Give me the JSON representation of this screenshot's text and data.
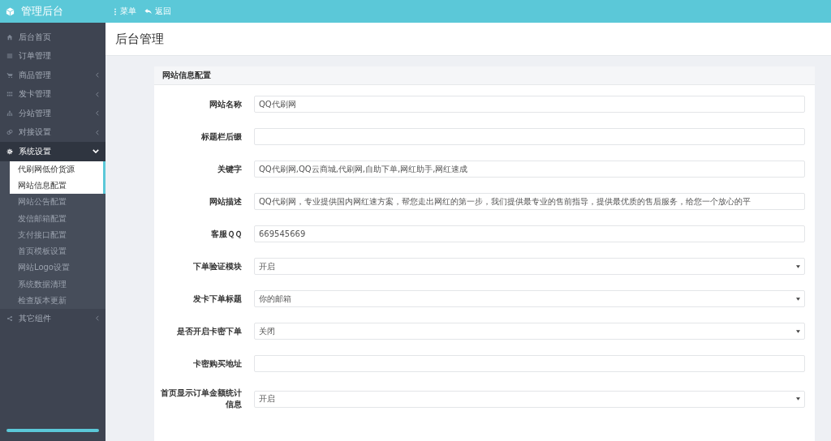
{
  "topbar": {
    "brand": "管理后台",
    "actions": [
      {
        "kind": "menu",
        "label": "菜单"
      },
      {
        "kind": "back",
        "label": "返回"
      }
    ]
  },
  "sidebar": {
    "items": [
      {
        "label": "后台首页"
      },
      {
        "label": "订单管理"
      },
      {
        "label": "商品管理",
        "expanded": false
      },
      {
        "label": "发卡管理",
        "expanded": false
      },
      {
        "label": "分站管理",
        "expanded": false
      },
      {
        "label": "对接设置",
        "expanded": false
      },
      {
        "label": "系统设置",
        "expanded": true,
        "children": [
          {
            "label": "代刷网低价货源",
            "selected": true
          },
          {
            "label": "网站信息配置",
            "selected": true
          },
          {
            "label": "网站公告配置",
            "selected": false
          },
          {
            "label": "发信邮箱配置",
            "selected": false
          },
          {
            "label": "支付接口配置",
            "selected": false
          },
          {
            "label": "首页模板设置",
            "selected": false
          },
          {
            "label": "网站Logo设置",
            "selected": false
          },
          {
            "label": "系统数据清理",
            "selected": false
          },
          {
            "label": "检查版本更新",
            "selected": false
          }
        ]
      },
      {
        "label": "其它组件",
        "expanded": false
      }
    ]
  },
  "page": {
    "title": "后台管理"
  },
  "panel": {
    "title": "网站信息配置",
    "fields": [
      {
        "kind": "text",
        "label": "网站名称",
        "value": "QQ代刷网"
      },
      {
        "kind": "text",
        "label": "标题栏后缀"
      },
      {
        "kind": "text",
        "label": "关键字",
        "value": "QQ代刷网,QQ云商城,代刷网,自助下单,网红助手,网红速成"
      },
      {
        "kind": "text",
        "label": "网站描述",
        "value": "QQ代刷网，专业提供国内网红速方案，帮您走出网红的第一步，我们提供最专业的售前指导，提供最优质的售后服务，给您一个放心的平"
      },
      {
        "kind": "text",
        "label": "客服ＱＱ",
        "value": "669545669"
      },
      {
        "kind": "select",
        "label": "下单验证模块",
        "value": "开启"
      },
      {
        "kind": "select",
        "label": "发卡下单标题",
        "value": "你的邮箱"
      },
      {
        "kind": "select",
        "label": "是否开启卡密下单",
        "value": "关闭"
      },
      {
        "kind": "text",
        "label": "卡密购买地址"
      },
      {
        "kind": "select",
        "label": "首页显示订单金额统计信息",
        "value": "开启"
      }
    ]
  }
}
